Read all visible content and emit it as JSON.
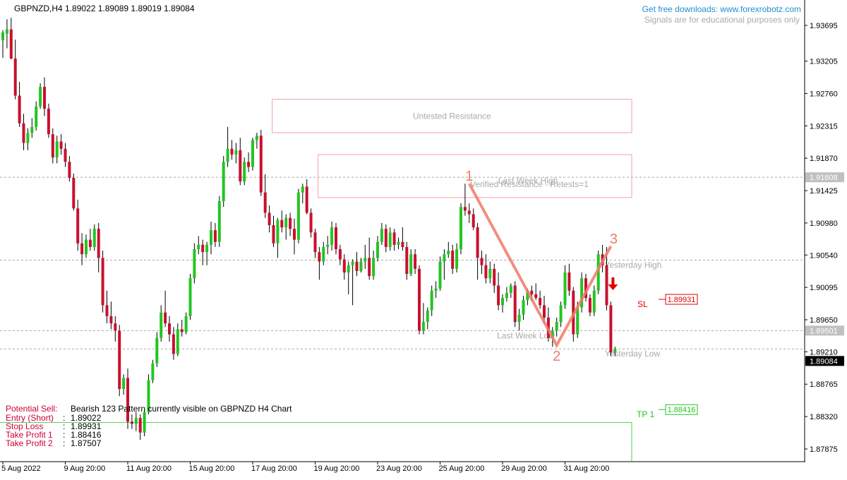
{
  "header": {
    "symbol_line": "GBPNZD,H4  1.89022 1.89089 1.89019 1.89084",
    "promo_link": "Get free downloads: www.forexrobotz.com",
    "disclaimer": "Signals are for educational purposes only"
  },
  "colors": {
    "bull": "#22c522",
    "bear": "#c8102e",
    "zone": "#f2a0a8",
    "pattern": "#f07a6a",
    "arrow": "#e00000",
    "tp": "#22c522",
    "sl": "#e00000",
    "promo": "#1e90d0",
    "label_red": "#cc0033"
  },
  "chart_data": {
    "type": "candlestick",
    "symbol": "GBPNZD",
    "timeframe": "H4",
    "ylim": [
      1.8758,
      1.9416
    ],
    "y_ticks": [
      "1.93695",
      "1.93205",
      "1.92760",
      "1.92315",
      "1.91870",
      "1.91425",
      "1.90980",
      "1.90540",
      "1.90095",
      "1.89650",
      "1.89210",
      "1.88765",
      "1.88320",
      "1.87875"
    ],
    "x_ticks": [
      {
        "label": "5 Aug 2022",
        "index": 0
      },
      {
        "label": "9 Aug 20:00",
        "index": 15
      },
      {
        "label": "11 Aug 20:00",
        "index": 30
      },
      {
        "label": "15 Aug 20:00",
        "index": 45
      },
      {
        "label": "17 Aug 20:00",
        "index": 60
      },
      {
        "label": "19 Aug 20:00",
        "index": 75
      },
      {
        "label": "23 Aug 20:00",
        "index": 90
      },
      {
        "label": "25 Aug 20:00",
        "index": 105
      },
      {
        "label": "29 Aug 20:00",
        "index": 120
      },
      {
        "label": "31 Aug 20:00",
        "index": 135
      }
    ],
    "price_markers": [
      {
        "label": "1.91608",
        "value": 1.91608,
        "style": "grey"
      },
      {
        "label": "1.89501",
        "value": 1.89501,
        "style": "grey"
      },
      {
        "label": "1.89084",
        "value": 1.89084,
        "style": "current"
      }
    ],
    "reference_lines": [
      {
        "label": "Last Week High",
        "value": 1.91608
      },
      {
        "label": "Yesterday High",
        "value": 1.9047
      },
      {
        "label": "Last Week Low",
        "value": 1.89501
      },
      {
        "label": "Yesterday Low",
        "value": 1.8925
      }
    ],
    "zones": [
      {
        "label": "Untested Resistance",
        "top": 1.9268,
        "bottom": 1.9222,
        "start_index": 63
      },
      {
        "label": "Verified Resistance - Retests=1",
        "top": 1.9192,
        "bottom": 1.9133,
        "start_index": 74
      }
    ],
    "pattern_123": {
      "name": "Bearish 123",
      "points": [
        {
          "label": "1",
          "index": 112,
          "value": 1.9152
        },
        {
          "label": "2",
          "index": 133,
          "value": 1.893
        },
        {
          "label": "3",
          "index": 146,
          "value": 1.9066
        }
      ]
    },
    "signal_levels": [
      {
        "label": "SL",
        "value": 1.89931,
        "text": "1.89931"
      },
      {
        "label": "TP 1",
        "value": 1.88416,
        "text": "1.88416"
      }
    ],
    "signal_info": {
      "rows": [
        {
          "key": "Potential Sell:",
          "value": "Bearish 123 Pattern currently visible on GBPNZD H4 Chart"
        },
        {
          "key": "Entry (Short)",
          "value": "1.89022"
        },
        {
          "key": "Stop Loss",
          "value": "1.89931"
        },
        {
          "key": "Take Profit 1",
          "value": "1.88416"
        },
        {
          "key": "Take Profit 2",
          "value": "1.87507"
        }
      ]
    },
    "candles": [
      [
        1.9349,
        1.9363,
        1.9325,
        1.936
      ],
      [
        1.9358,
        1.9378,
        1.9338,
        1.9364
      ],
      [
        1.9364,
        1.938,
        1.9323,
        1.9324
      ],
      [
        1.9324,
        1.935,
        1.9268,
        1.9273
      ],
      [
        1.9273,
        1.9292,
        1.923,
        1.9235
      ],
      [
        1.9235,
        1.9248,
        1.9198,
        1.9208
      ],
      [
        1.9208,
        1.9228,
        1.9198,
        1.9222
      ],
      [
        1.9222,
        1.9242,
        1.9215,
        1.923
      ],
      [
        1.923,
        1.9265,
        1.9225,
        1.9258
      ],
      [
        1.9258,
        1.929,
        1.9255,
        1.9285
      ],
      [
        1.9285,
        1.9298,
        1.9245,
        1.9255
      ],
      [
        1.9255,
        1.9262,
        1.9215,
        1.922
      ],
      [
        1.922,
        1.9228,
        1.918,
        1.9188
      ],
      [
        1.9188,
        1.9218,
        1.918,
        1.921
      ],
      [
        1.921,
        1.922,
        1.9192,
        1.92
      ],
      [
        1.92,
        1.9208,
        1.9175,
        1.9182
      ],
      [
        1.9182,
        1.919,
        1.9155,
        1.916
      ],
      [
        1.916,
        1.9166,
        1.9115,
        1.9118
      ],
      [
        1.9118,
        1.913,
        1.906,
        1.907
      ],
      [
        1.907,
        1.9084,
        1.904,
        1.9055
      ],
      [
        1.9055,
        1.9082,
        1.905,
        1.9075
      ],
      [
        1.9075,
        1.909,
        1.906,
        1.9065
      ],
      [
        1.9065,
        1.9096,
        1.906,
        1.909
      ],
      [
        1.909,
        1.9098,
        1.903,
        1.905
      ],
      [
        1.905,
        1.906,
        1.8975,
        1.8985
      ],
      [
        1.8985,
        1.9005,
        1.896,
        1.897
      ],
      [
        1.897,
        1.899,
        1.8952,
        1.896
      ],
      [
        1.896,
        1.897,
        1.8935,
        1.895
      ],
      [
        1.895,
        1.8958,
        1.886,
        1.887
      ],
      [
        1.887,
        1.889,
        1.8862,
        1.8885
      ],
      [
        1.8885,
        1.8898,
        1.8815,
        1.8825
      ],
      [
        1.8825,
        1.8835,
        1.8815,
        1.8822
      ],
      [
        1.8822,
        1.8838,
        1.8812,
        1.883
      ],
      [
        1.883,
        1.8835,
        1.88,
        1.881
      ],
      [
        1.881,
        1.8842,
        1.8805,
        1.8838
      ],
      [
        1.8838,
        1.889,
        1.8835,
        1.8882
      ],
      [
        1.8882,
        1.891,
        1.8878,
        1.8905
      ],
      [
        1.8905,
        1.8948,
        1.89,
        1.894
      ],
      [
        1.894,
        1.8985,
        1.8935,
        1.8975
      ],
      [
        1.8975,
        1.9005,
        1.8955,
        1.896
      ],
      [
        1.896,
        1.897,
        1.8935,
        1.8945
      ],
      [
        1.8945,
        1.8955,
        1.891,
        1.8918
      ],
      [
        1.8918,
        1.896,
        1.8915,
        1.8952
      ],
      [
        1.8952,
        1.8965,
        1.8942,
        1.8948
      ],
      [
        1.8948,
        1.8975,
        1.8945,
        1.897
      ],
      [
        1.897,
        1.9028,
        1.8965,
        1.9022
      ],
      [
        1.9022,
        1.907,
        1.9015,
        1.9062
      ],
      [
        1.9062,
        1.908,
        1.9055,
        1.9068
      ],
      [
        1.9068,
        1.9075,
        1.904,
        1.9058
      ],
      [
        1.9058,
        1.9072,
        1.904,
        1.9068
      ],
      [
        1.9068,
        1.91,
        1.9055,
        1.9088
      ],
      [
        1.9088,
        1.9098,
        1.9065,
        1.9072
      ],
      [
        1.9072,
        1.9135,
        1.9065,
        1.9128
      ],
      [
        1.9128,
        1.919,
        1.912,
        1.9182
      ],
      [
        1.9182,
        1.923,
        1.9175,
        1.92
      ],
      [
        1.92,
        1.9212,
        1.9185,
        1.9192
      ],
      [
        1.9192,
        1.9208,
        1.918,
        1.9198
      ],
      [
        1.9198,
        1.9215,
        1.915,
        1.9155
      ],
      [
        1.9155,
        1.9188,
        1.915,
        1.9182
      ],
      [
        1.9182,
        1.9195,
        1.9168,
        1.9175
      ],
      [
        1.9175,
        1.9215,
        1.917,
        1.9212
      ],
      [
        1.9212,
        1.9222,
        1.92,
        1.9218
      ],
      [
        1.9218,
        1.9226,
        1.9135,
        1.914
      ],
      [
        1.914,
        1.9165,
        1.9105,
        1.9112
      ],
      [
        1.9112,
        1.9122,
        1.9085,
        1.9095
      ],
      [
        1.9095,
        1.9108,
        1.9065,
        1.907
      ],
      [
        1.907,
        1.9105,
        1.905,
        1.9102
      ],
      [
        1.9102,
        1.9115,
        1.9085,
        1.9092
      ],
      [
        1.9092,
        1.911,
        1.9075,
        1.9105
      ],
      [
        1.9105,
        1.9112,
        1.908,
        1.909
      ],
      [
        1.909,
        1.9104,
        1.9055,
        1.9075
      ],
      [
        1.9075,
        1.9145,
        1.907,
        1.914
      ],
      [
        1.914,
        1.9152,
        1.9125,
        1.9148
      ],
      [
        1.9148,
        1.9158,
        1.911,
        1.9112
      ],
      [
        1.9112,
        1.9118,
        1.9078,
        1.9085
      ],
      [
        1.9085,
        1.909,
        1.905,
        1.9058
      ],
      [
        1.9058,
        1.9065,
        1.902,
        1.9045
      ],
      [
        1.9045,
        1.9072,
        1.904,
        1.9065
      ],
      [
        1.9065,
        1.908,
        1.9055,
        1.9068
      ],
      [
        1.9068,
        1.91,
        1.906,
        1.9092
      ],
      [
        1.9092,
        1.9098,
        1.9055,
        1.9062
      ],
      [
        1.9062,
        1.9068,
        1.904,
        1.9048
      ],
      [
        1.9048,
        1.9055,
        1.902,
        1.903
      ],
      [
        1.903,
        1.9045,
        1.9,
        1.904
      ],
      [
        1.904,
        1.9048,
        1.8985,
        1.9045
      ],
      [
        1.9045,
        1.9058,
        1.9025,
        1.9032
      ],
      [
        1.9032,
        1.905,
        1.903,
        1.9045
      ],
      [
        1.9045,
        1.9068,
        1.9035,
        1.905
      ],
      [
        1.905,
        1.9078,
        1.902,
        1.9025
      ],
      [
        1.9025,
        1.906,
        1.902,
        1.905
      ],
      [
        1.905,
        1.908,
        1.9045,
        1.9072
      ],
      [
        1.9072,
        1.9098,
        1.9068,
        1.909
      ],
      [
        1.909,
        1.9096,
        1.9058,
        1.9065
      ],
      [
        1.9065,
        1.9092,
        1.906,
        1.9085
      ],
      [
        1.9085,
        1.909,
        1.906,
        1.9068
      ],
      [
        1.9068,
        1.9078,
        1.9062,
        1.9072
      ],
      [
        1.9072,
        1.9092,
        1.906,
        1.9065
      ],
      [
        1.9065,
        1.9072,
        1.902,
        1.9028
      ],
      [
        1.9028,
        1.9062,
        1.9025,
        1.9055
      ],
      [
        1.9055,
        1.9062,
        1.9028,
        1.9035
      ],
      [
        1.9035,
        1.904,
        1.8945,
        1.895
      ],
      [
        1.895,
        1.8988,
        1.8945,
        1.8962
      ],
      [
        1.8962,
        1.8982,
        1.8952,
        1.8978
      ],
      [
        1.8978,
        1.9012,
        1.897,
        1.9005
      ],
      [
        1.9005,
        1.9018,
        1.8995,
        1.9008
      ],
      [
        1.9008,
        1.9052,
        1.9005,
        1.9045
      ],
      [
        1.9045,
        1.9062,
        1.902,
        1.9055
      ],
      [
        1.9055,
        1.9072,
        1.905,
        1.906
      ],
      [
        1.906,
        1.9068,
        1.9028,
        1.9035
      ],
      [
        1.9035,
        1.907,
        1.903,
        1.9062
      ],
      [
        1.9062,
        1.9125,
        1.9055,
        1.912
      ],
      [
        1.912,
        1.9152,
        1.9108,
        1.9115
      ],
      [
        1.9115,
        1.9125,
        1.9098,
        1.911
      ],
      [
        1.911,
        1.9118,
        1.9088,
        1.9092
      ],
      [
        1.9092,
        1.9098,
        1.902,
        1.905
      ],
      [
        1.905,
        1.906,
        1.9028,
        1.904
      ],
      [
        1.904,
        1.9055,
        1.9015,
        1.9022
      ],
      [
        1.9022,
        1.9045,
        1.9015,
        1.9035
      ],
      [
        1.9035,
        1.9042,
        1.9002,
        1.9012
      ],
      [
        1.9012,
        1.903,
        1.8978,
        1.8985
      ],
      [
        1.8985,
        1.9,
        1.8975,
        1.8995
      ],
      [
        1.8995,
        1.901,
        1.899,
        1.9002
      ],
      [
        1.9002,
        1.9015,
        1.8995,
        1.9012
      ],
      [
        1.9012,
        1.9018,
        1.8955,
        1.8962
      ],
      [
        1.8962,
        1.898,
        1.895,
        1.8972
      ],
      [
        1.8972,
        1.8998,
        1.8965,
        1.8992
      ],
      [
        1.8992,
        1.9008,
        1.8985,
        1.9005
      ],
      [
        1.9005,
        1.9012,
        1.899,
        1.9
      ],
      [
        1.9,
        1.9015,
        1.8992,
        1.8995
      ],
      [
        1.8995,
        1.9005,
        1.898,
        1.8985
      ],
      [
        1.8985,
        1.8998,
        1.896,
        1.8968
      ],
      [
        1.8968,
        1.8982,
        1.8935,
        1.894
      ],
      [
        1.894,
        1.8955,
        1.8928,
        1.895
      ],
      [
        1.895,
        1.8968,
        1.8942,
        1.8962
      ],
      [
        1.8962,
        1.899,
        1.8955,
        1.8985
      ],
      [
        1.8985,
        1.904,
        1.898,
        1.903
      ],
      [
        1.903,
        1.9042,
        1.8998,
        1.9005
      ],
      [
        1.9005,
        1.901,
        1.8935,
        1.8945
      ],
      [
        1.8945,
        1.899,
        1.894,
        1.8982
      ],
      [
        1.8982,
        1.903,
        1.8975,
        1.9022
      ],
      [
        1.9022,
        1.9028,
        1.899,
        1.8995
      ],
      [
        1.8995,
        1.9,
        1.897,
        1.8975
      ],
      [
        1.8975,
        1.9012,
        1.897,
        1.9005
      ],
      [
        1.9005,
        1.906,
        1.9,
        1.9055
      ],
      [
        1.9055,
        1.9068,
        1.903,
        1.904
      ],
      [
        1.904,
        1.9065,
        1.8978,
        1.8985
      ],
      [
        1.8985,
        1.899,
        1.8915,
        1.892
      ],
      [
        1.892,
        1.8928,
        1.8915,
        1.8925
      ]
    ]
  }
}
